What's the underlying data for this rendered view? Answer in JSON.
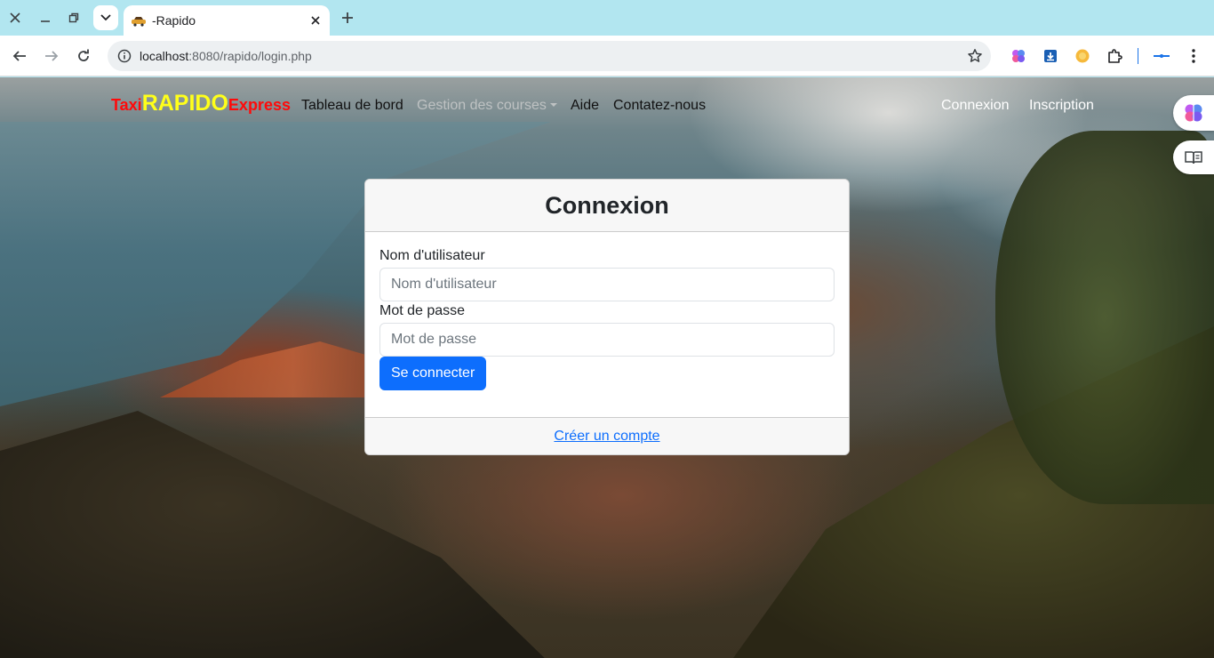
{
  "browser": {
    "tab_title": "-Rapido",
    "url_host": "localhost",
    "url_path": ":8080/rapido/login.php"
  },
  "navbar": {
    "brand_part1": "Taxi",
    "brand_part2": "RAPIDO",
    "brand_part3": "Express",
    "links": [
      {
        "label": "Tableau de bord"
      },
      {
        "label": "Gestion des courses"
      },
      {
        "label": "Aide"
      },
      {
        "label": "Contatez-nous"
      }
    ],
    "right_links": [
      {
        "label": "Connexion"
      },
      {
        "label": "Inscription"
      }
    ]
  },
  "login": {
    "title": "Connexion",
    "username_label": "Nom d'utilisateur",
    "username_placeholder": "Nom d'utilisateur",
    "password_label": "Mot de passe",
    "password_placeholder": "Mot de passe",
    "submit_label": "Se connecter",
    "footer_link": "Créer un compte"
  },
  "colors": {
    "brand_red": "#ff0a0a",
    "brand_yellow": "#ffff1a",
    "primary": "#0d6efd",
    "chrome_tabbar": "#b2e6f0"
  }
}
